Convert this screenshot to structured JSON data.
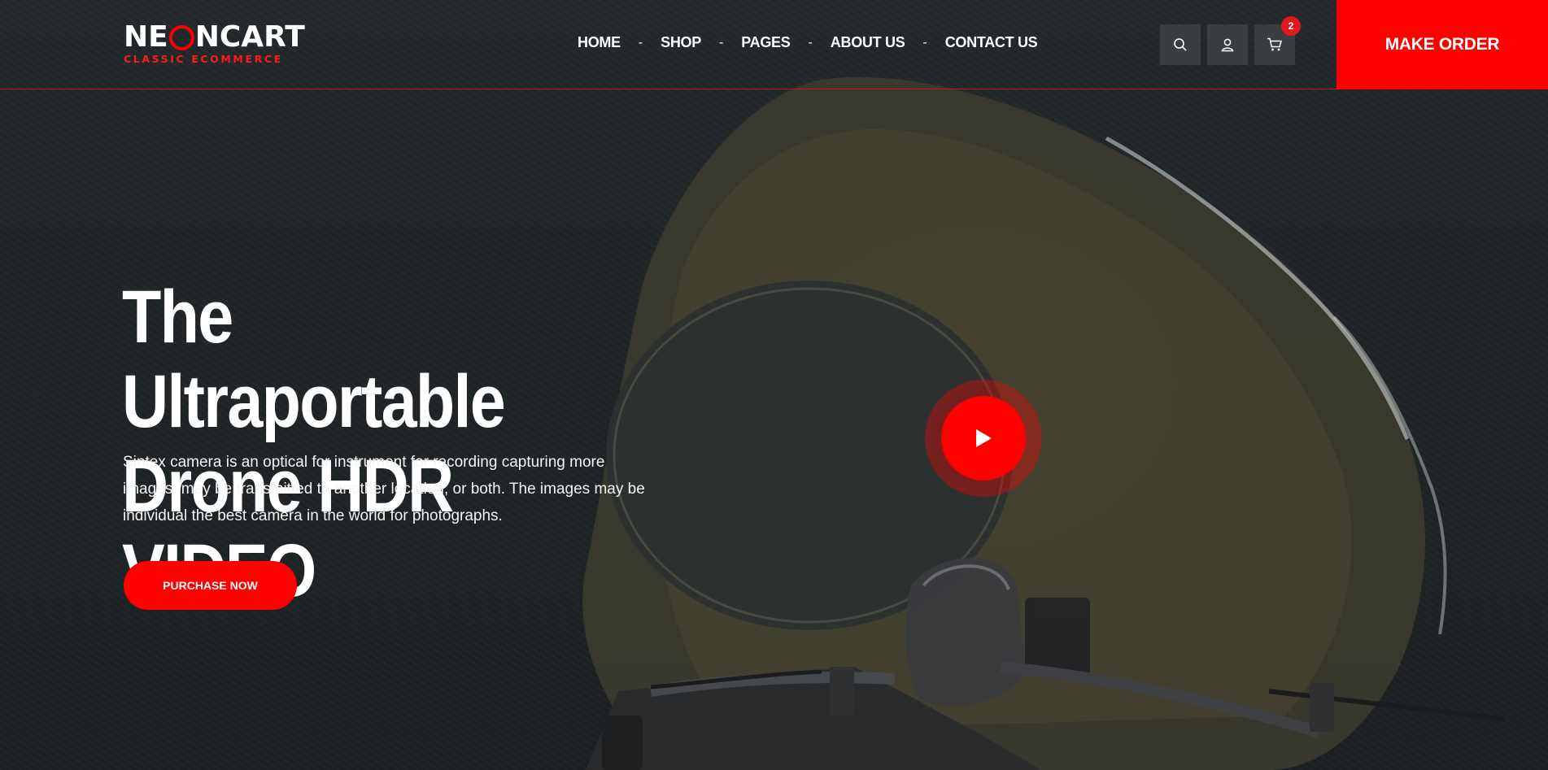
{
  "brand": {
    "logo_text": "NEONCART",
    "logo_prefix": "NE",
    "logo_suffix": "NCART",
    "tagline": "CLASSIC ECOMMERCE",
    "accent_color": "#ff0000"
  },
  "nav": {
    "items": [
      {
        "label": "HOME"
      },
      {
        "label": "SHOP"
      },
      {
        "label": "PAGES"
      },
      {
        "label": "ABOUT US"
      },
      {
        "label": "CONTACT US"
      }
    ],
    "separator": "-"
  },
  "header_icons": {
    "search": "search-icon",
    "account": "user-icon",
    "cart": "cart-icon",
    "cart_count": "2"
  },
  "header_cta": {
    "label": "MAKE ORDER"
  },
  "hero": {
    "title_line1": "The Ultraportable",
    "title_line2": "Drone HDR VIDEO",
    "description": "Sintex camera is an optical for instrument for recording capturing more images, may be transmitted to another location, or both. The images may be individual the best camera in the world for photographs.",
    "button_label": "PURCHASE NOW",
    "play_icon": "play-icon"
  }
}
